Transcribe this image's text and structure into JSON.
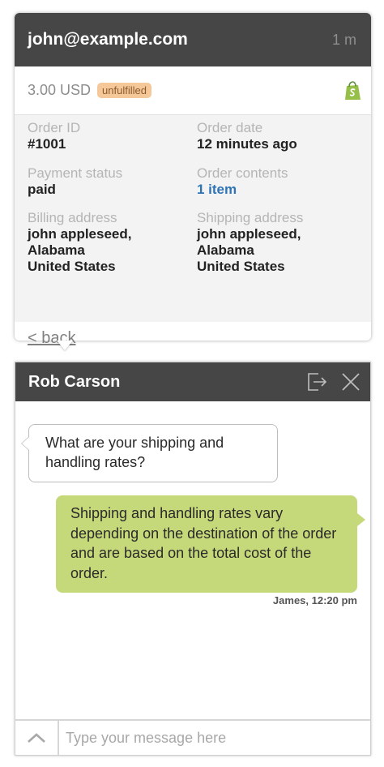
{
  "order": {
    "email": "john@example.com",
    "age": "1 m",
    "amount": "3.00 USD",
    "status": "unfulfilled",
    "store_icon": "shopify-bag-icon",
    "fields": {
      "order_id_label": "Order ID",
      "order_id": "#1001",
      "order_date_label": "Order date",
      "order_date": "12 minutes ago",
      "payment_status_label": "Payment status",
      "payment_status": "paid",
      "order_contents_label": "Order contents",
      "order_contents": "1 item",
      "billing_label": "Billing address",
      "billing_lines": [
        "john appleseed,",
        "Alabama",
        "United States"
      ],
      "shipping_label": "Shipping address",
      "shipping_lines": [
        "john appleseed,",
        "Alabama",
        "United States"
      ]
    },
    "back_label": "< back"
  },
  "chat": {
    "title": "Rob Carson",
    "header_icons": [
      "exit-icon",
      "close-icon"
    ],
    "messages": [
      {
        "direction": "incoming",
        "text": "What are your shipping and handling rates?"
      },
      {
        "direction": "outgoing",
        "text": "Shipping and handling rates vary depending on the destination of the order and are based on the total cost of the order.",
        "meta": "James, 12:20 pm"
      }
    ],
    "composer": {
      "placeholder": "Type your message here",
      "expand_icon": "chevron-up-icon"
    }
  },
  "colors": {
    "header_bg": "#464646",
    "status_pill": "#f5c89a",
    "link": "#2e74b5",
    "outgoing_bubble": "#c5d97a",
    "shopify": "#95bf47"
  }
}
